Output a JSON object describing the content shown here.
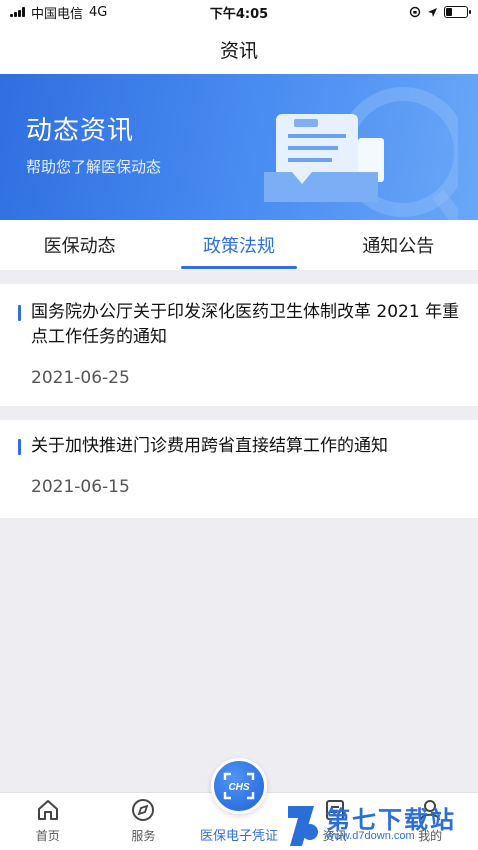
{
  "status_bar": {
    "carrier": "中国电信",
    "network": "4G",
    "time": "下午4:05"
  },
  "nav": {
    "title": "资讯"
  },
  "banner": {
    "title": "动态资讯",
    "subtitle": "帮助您了解医保动态"
  },
  "tabs": [
    {
      "label": "医保动态",
      "active": false
    },
    {
      "label": "政策法规",
      "active": true
    },
    {
      "label": "通知公告",
      "active": false
    }
  ],
  "articles": [
    {
      "title": "国务院办公厅关于印发深化医药卫生体制改革 2021 年重点工作任务的通知",
      "date": "2021-06-25"
    },
    {
      "title": "关于加快推进门诊费用跨省直接结算工作的通知",
      "date": "2021-06-15"
    }
  ],
  "bottom_nav": [
    {
      "label": "首页",
      "icon": "home-icon"
    },
    {
      "label": "服务",
      "icon": "compass-icon"
    },
    {
      "label": "医保电子凭证",
      "icon": "chs-scan-icon"
    },
    {
      "label": "资讯",
      "icon": "news-icon"
    },
    {
      "label": "我的",
      "icon": "user-icon"
    }
  ],
  "center_badge": {
    "text": "CHS"
  },
  "watermark": {
    "text": "第七下载站",
    "url": "www.d7down.com"
  },
  "colors": {
    "accent": "#2e6fe0",
    "banner_start": "#2f6fe0",
    "banner_end": "#6aa7f7",
    "background": "#eeeef2"
  }
}
